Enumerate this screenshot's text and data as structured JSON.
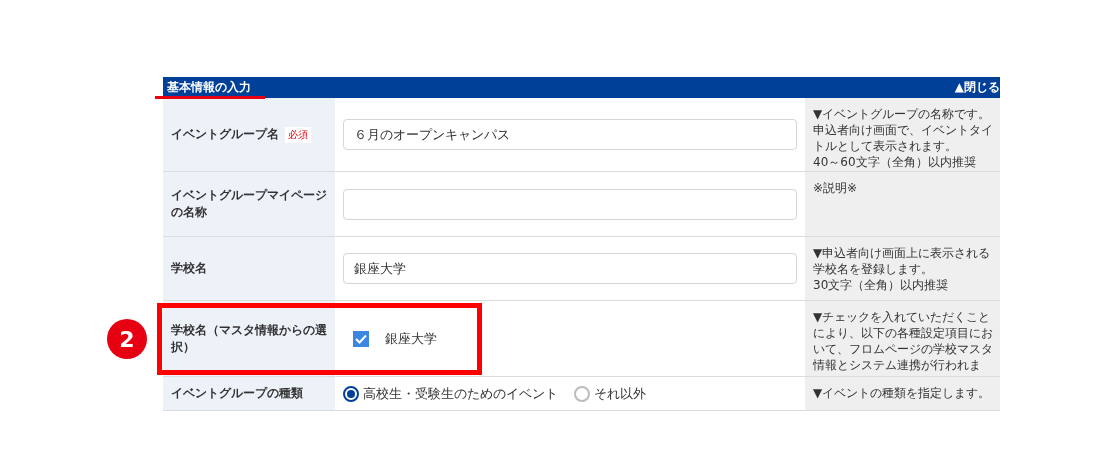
{
  "section": {
    "title": "基本情報の入力",
    "toggle": "▲閉じる"
  },
  "callout": {
    "number": "2"
  },
  "rows": [
    {
      "kind": "text",
      "label": "イベントグループ名",
      "required": "必須",
      "value": "６月のオープンキャンパス",
      "note": [
        "▼イベントグループの名称です。",
        "申込者向け画面で、イベントタイ",
        "トルとして表示されます。",
        "40～60文字（全角）以内推奨"
      ]
    },
    {
      "kind": "text",
      "label": "イベントグループマイページの名称",
      "note": [
        "※説明※"
      ]
    },
    {
      "kind": "text",
      "label": "学校名",
      "value": "銀座大学",
      "note": [
        "▼申込者向け画面上に表示される",
        "学校名を登録します。",
        "30文字（全角）以内推奨"
      ]
    },
    {
      "kind": "checkbox",
      "label": "学校名（マスタ情報からの選択）",
      "highlighted": true,
      "checked": true,
      "option": "銀座大学",
      "note": [
        "▼チェックを入れていただくこと",
        "により、以下の各種設定項目にお",
        "いて、フロムページの学校マスタ",
        "情報とシステム連携が行われま"
      ]
    },
    {
      "kind": "radio",
      "label": "イベントグループの種類",
      "options": [
        {
          "label": "高校生・受験生のためのイベント",
          "selected": true
        },
        {
          "label": "それ以外",
          "selected": false
        }
      ],
      "note": [
        "▼イベントの種類を指定します。"
      ]
    }
  ]
}
